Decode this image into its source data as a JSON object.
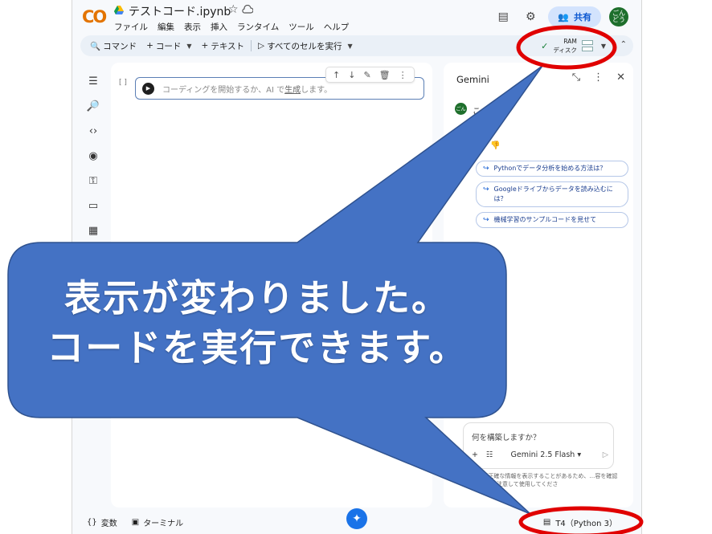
{
  "app": {
    "logo": "CO",
    "doc_title": "テストコード.ipynb",
    "menu": [
      "ファイル",
      "編集",
      "表示",
      "挿入",
      "ランタイム",
      "ツール",
      "ヘルプ"
    ],
    "share_label": "共有",
    "avatar_text": "ごん\nどう"
  },
  "toolbar": {
    "command": "コマンド",
    "code": "コード",
    "text": "テキスト",
    "run_all": "すべてのセルを実行",
    "ram": "RAM",
    "disk": "ディスク"
  },
  "cell": {
    "bracket": "[ ]",
    "placeholder_pre": "コーディングを開始するか、AI で",
    "placeholder_link": "生成",
    "placeholder_post": "します。"
  },
  "gemini": {
    "title": "Gemini",
    "greeting_partial": "こ",
    "hello_partial": "ちは！",
    "suggestions": [
      "Pythonでデータ分析を始める方法は？",
      "Googleドライブからデータを読み込むには？",
      "機械学習のサンプルコードを見せて"
    ],
    "prompt_placeholder": "何を構築しますか？",
    "model": "Gemini 2.5 Flash",
    "disclaimer": "mini は不正確な情報を表示することがあるため、…容を確認し、コードは注意して使用してくださ"
  },
  "statusbar": {
    "variables": "変数",
    "terminal": "ターミナル",
    "runtime": "T4（Python 3）"
  },
  "callout": {
    "line1": "表示が変わりました。",
    "line2": "コードを実行できます。",
    "fill_color": "#4472c4",
    "highlight_color": "#e00000"
  }
}
